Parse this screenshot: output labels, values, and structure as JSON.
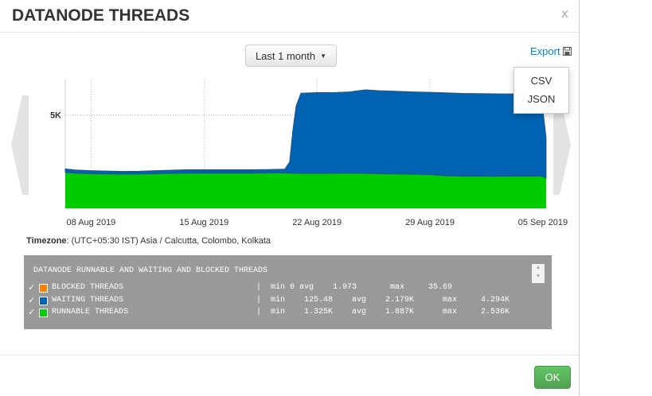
{
  "dialog": {
    "title": "DATANODE THREADS",
    "close_label": "x",
    "ok_label": "OK"
  },
  "toolbar": {
    "range_label": "Last 1 month",
    "export_label": "Export",
    "export_options": [
      "CSV",
      "JSON"
    ]
  },
  "timezone": {
    "label": "Timezone",
    "value": ": (UTC+05:30 IST) Asia / Calcutta, Colombo, Kolkata"
  },
  "colors": {
    "blocked": "#ff7f00",
    "waiting": "#0063b1",
    "runnable": "#00cc00"
  },
  "chart_data": {
    "type": "area",
    "stacked": true,
    "x_unit": "days since 08 Aug 2019",
    "xlim": [
      -1.6,
      28.2
    ],
    "ylim": [
      0,
      6900
    ],
    "y_ticks": [
      {
        "value": 5000,
        "label": "5K"
      }
    ],
    "x_ticks": [
      {
        "value": 0,
        "label": "08 Aug 2019"
      },
      {
        "value": 7,
        "label": "15 Aug 2019"
      },
      {
        "value": 14,
        "label": "22 Aug 2019"
      },
      {
        "value": 21,
        "label": "29 Aug 2019"
      },
      {
        "value": 28,
        "label": "05 Sep 2019"
      }
    ],
    "x": [
      -1.6,
      -1,
      0,
      1,
      2,
      3,
      4,
      5,
      6,
      7,
      8,
      9,
      10,
      11,
      12,
      12.3,
      12.5,
      12.7,
      13,
      14,
      15,
      16,
      17,
      18,
      19,
      20,
      21,
      22,
      23,
      24,
      25,
      26,
      27,
      27.8,
      28,
      28.2
    ],
    "series": [
      {
        "name": "RUNNABLE THREADS",
        "values": [
          1920,
          1880,
          1850,
          1840,
          1830,
          1830,
          1850,
          1870,
          1880,
          1880,
          1880,
          1880,
          1880,
          1890,
          1900,
          1880,
          1880,
          1870,
          1870,
          1870,
          1870,
          1880,
          1870,
          1850,
          1840,
          1820,
          1800,
          1740,
          1720,
          1720,
          1710,
          1720,
          1720,
          1720,
          1700,
          1600
        ]
      },
      {
        "name": "WAITING THREADS",
        "values": [
          200,
          180,
          170,
          160,
          150,
          160,
          170,
          180,
          190,
          190,
          190,
          190,
          190,
          190,
          200,
          600,
          2300,
          3600,
          4300,
          4330,
          4330,
          4360,
          4480,
          4450,
          4430,
          4420,
          4420,
          4450,
          4440,
          4430,
          4430,
          4410,
          4400,
          4380,
          3600,
          2200
        ]
      },
      {
        "name": "BLOCKED THREADS",
        "values": [
          0,
          0,
          0,
          0,
          0,
          0,
          0,
          0,
          0,
          0,
          0,
          0,
          0,
          0,
          0,
          0,
          0,
          0,
          0,
          0,
          0,
          0,
          0,
          0,
          0,
          0,
          0,
          0,
          0,
          0,
          0,
          0,
          0,
          0,
          0,
          0
        ]
      }
    ]
  },
  "legend": {
    "title": "DATANODE RUNNABLE AND WAITING AND BLOCKED THREADS",
    "rows": [
      {
        "check": "✓",
        "name": "BLOCKED THREADS",
        "stats": "|  min 0 avg    1.973       max     35.69"
      },
      {
        "check": "✓",
        "name": "WAITING THREADS",
        "stats": "|  min    125.48    avg    2.179K      max     4.294K"
      },
      {
        "check": "✓",
        "name": "RUNNABLE THREADS",
        "stats": "|  min    1.325K    avg    1.887K      max     2.536K"
      }
    ]
  }
}
